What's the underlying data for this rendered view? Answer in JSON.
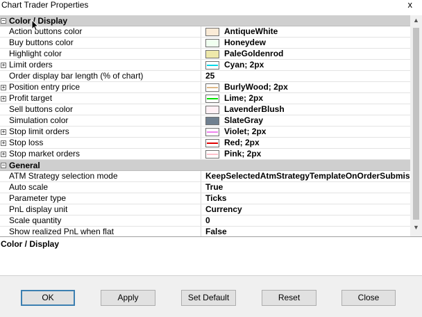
{
  "window": {
    "title": "Chart Trader Properties",
    "close_glyph": "x"
  },
  "categories": {
    "color_display": "Color / Display",
    "general": "General"
  },
  "rows": [
    {
      "name": "Action buttons color",
      "value": "AntiqueWhite",
      "expandable": false,
      "swatch": "#FAEBD7",
      "line": null
    },
    {
      "name": "Buy buttons color",
      "value": "Honeydew",
      "expandable": false,
      "swatch": "#F0FFF0",
      "line": null
    },
    {
      "name": "Highlight color",
      "value": "PaleGoldenrod",
      "expandable": false,
      "swatch": "#EEE8AA",
      "line": null
    },
    {
      "name": "Limit orders",
      "value": "Cyan; 2px",
      "expandable": true,
      "swatch": "#ffffff",
      "line": "#00D8E8"
    },
    {
      "name": "Order display bar length (% of chart)",
      "value": "25",
      "expandable": false,
      "swatch": null,
      "line": null
    },
    {
      "name": "Position entry price",
      "value": "BurlyWood; 2px",
      "expandable": true,
      "swatch": "#ffffff",
      "line": "#DEB887"
    },
    {
      "name": "Profit target",
      "value": "Lime; 2px",
      "expandable": true,
      "swatch": "#ffffff",
      "line": "#00E000"
    },
    {
      "name": "Sell buttons color",
      "value": "LavenderBlush",
      "expandable": false,
      "swatch": "#FFF0F5",
      "line": null
    },
    {
      "name": "Simulation color",
      "value": "SlateGray",
      "expandable": false,
      "swatch": "#708090",
      "line": null
    },
    {
      "name": "Stop limit orders",
      "value": "Violet; 2px",
      "expandable": true,
      "swatch": "#ffffff",
      "line": "#EE82EE"
    },
    {
      "name": "Stop loss",
      "value": "Red; 2px",
      "expandable": true,
      "swatch": "#ffffff",
      "line": "#E00000"
    },
    {
      "name": "Stop market orders",
      "value": "Pink; 2px",
      "expandable": true,
      "swatch": "#ffffff",
      "line": "#FFC0CB"
    }
  ],
  "general_rows": [
    {
      "name": "ATM Strategy selection mode",
      "value": "KeepSelectedAtmStrategyTemplateOnOrderSubmissi"
    },
    {
      "name": "Auto scale",
      "value": "True"
    },
    {
      "name": "Parameter type",
      "value": "Ticks"
    },
    {
      "name": "PnL display unit",
      "value": "Currency"
    },
    {
      "name": "Scale quantity",
      "value": "0"
    },
    {
      "name": "Show realized PnL when flat",
      "value": "False"
    }
  ],
  "description": {
    "title": "Color / Display"
  },
  "buttons": {
    "ok": "OK",
    "apply": "Apply",
    "set_default": "Set Default",
    "reset": "Reset",
    "close": "Close"
  },
  "icons": {
    "collapse": "⊟",
    "expand": "⊞",
    "scroll_up": "▲",
    "scroll_down": "▼"
  }
}
